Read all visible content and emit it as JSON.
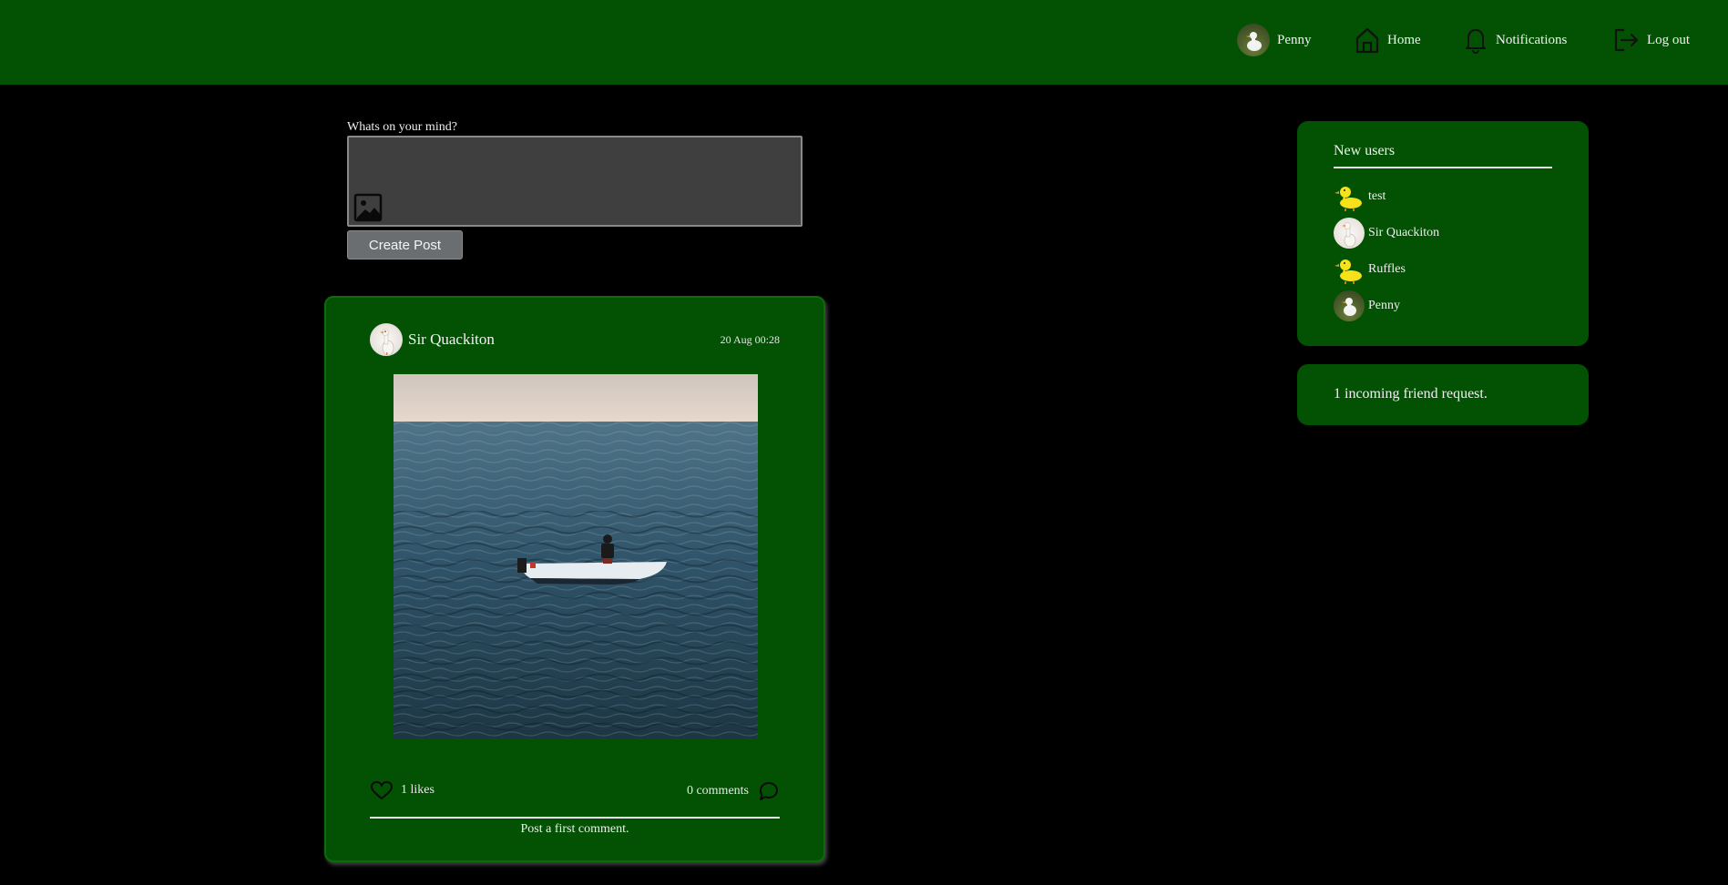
{
  "nav": {
    "profile_name": "Penny",
    "home_label": "Home",
    "notifications_label": "Notifications",
    "logout_label": "Log out"
  },
  "composer": {
    "label": "Whats on your mind?",
    "value": "",
    "create_button": "Create Post"
  },
  "post": {
    "author": "Sir Quackiton",
    "timestamp": "20 Aug 00:28",
    "likes": "1 likes",
    "comments": "0 comments",
    "empty_comments": "Post a first comment."
  },
  "sidebar": {
    "new_users_title": "New users",
    "users": [
      {
        "name": "test",
        "avatar": "yellow-duck"
      },
      {
        "name": "Sir Quackiton",
        "avatar": "white-duck"
      },
      {
        "name": "Ruffles",
        "avatar": "yellow-duck"
      },
      {
        "name": "Penny",
        "avatar": "duck-photo"
      }
    ],
    "friend_requests": "1 incoming friend request."
  },
  "colors": {
    "brand_green": "#035203",
    "background": "#000000",
    "text": "#e8e8e8"
  }
}
